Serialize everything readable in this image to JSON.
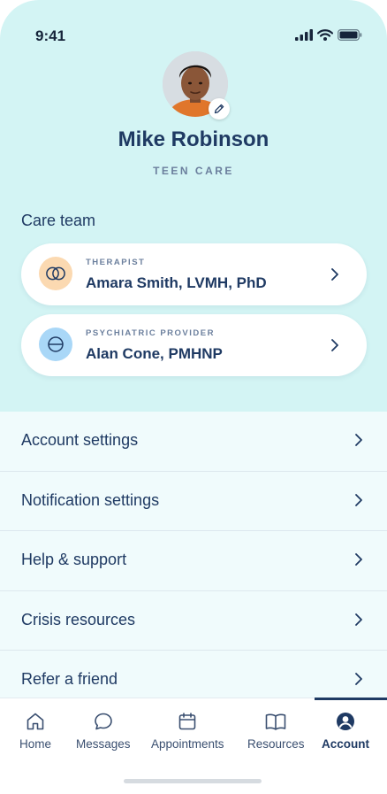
{
  "status_bar": {
    "time": "9:41",
    "icons": [
      "cellular-signal-icon",
      "wifi-icon",
      "battery-icon"
    ]
  },
  "profile": {
    "name": "Mike Robinson",
    "plan": "TEEN CARE",
    "edit_icon": "pencil-icon"
  },
  "care_team": {
    "title": "Care team",
    "members": [
      {
        "role": "THERAPIST",
        "name": "Amara Smith, LVMH, PhD",
        "icon": "intersecting-circles-icon",
        "icon_bg": "#fbd9b1"
      },
      {
        "role": "PSYCHIATRIC PROVIDER",
        "name": "Alan Cone, PMHNP",
        "icon": "circle-minus-icon",
        "icon_bg": "#a9d7f7"
      }
    ]
  },
  "menu": {
    "items": [
      {
        "label": "Account settings"
      },
      {
        "label": "Notification settings"
      },
      {
        "label": "Help & support"
      },
      {
        "label": "Crisis resources"
      },
      {
        "label": "Refer a friend"
      }
    ]
  },
  "tab_bar": {
    "tabs": [
      {
        "label": "Home",
        "icon": "home-icon",
        "active": false
      },
      {
        "label": "Messages",
        "icon": "chat-bubble-icon",
        "active": false
      },
      {
        "label": "Appointments",
        "icon": "calendar-icon",
        "active": false
      },
      {
        "label": "Resources",
        "icon": "book-icon",
        "active": false
      },
      {
        "label": "Account",
        "icon": "account-icon",
        "active": true
      }
    ]
  },
  "colors": {
    "header_bg": "#d3f4f4",
    "menu_bg": "#f0fbfc",
    "primary_text": "#1f3a63",
    "muted_text": "#6b7f9d"
  }
}
